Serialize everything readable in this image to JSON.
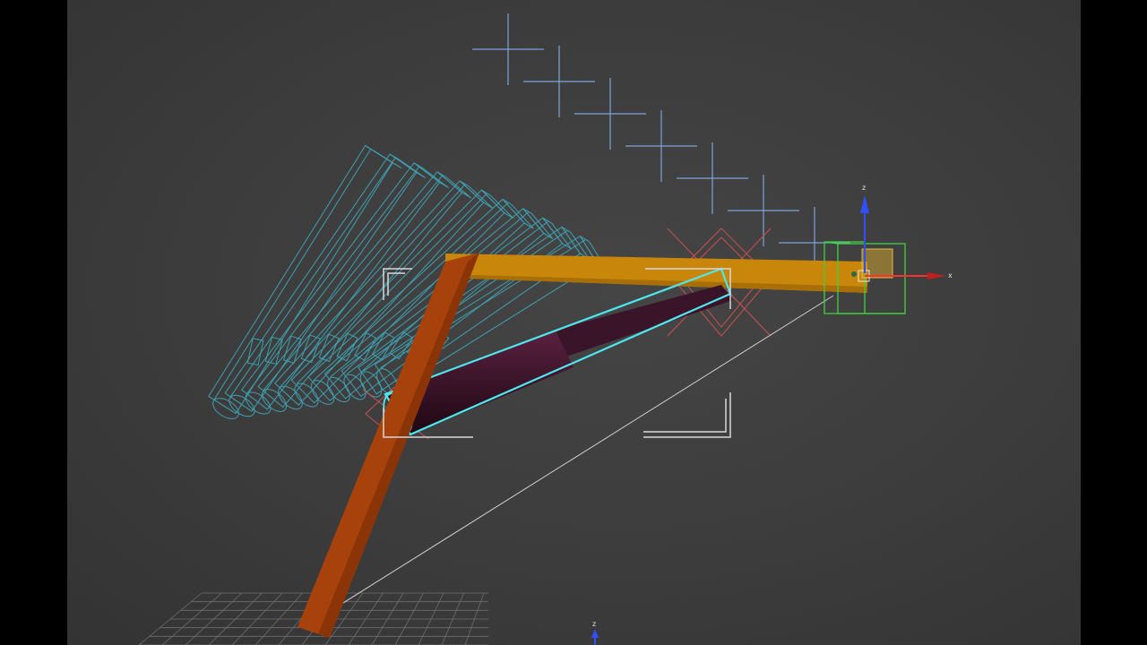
{
  "viewport": {
    "background": "#3f3f3f",
    "letterbox_color": "#000000"
  },
  "gizmo_main": {
    "axis_z": "z",
    "axis_x": "x"
  },
  "gizmo_bottom": {
    "axis_z": "z"
  },
  "colors": {
    "ghost_wireframe": "#3f9fb0",
    "helper_cross": "#7fa3d8",
    "arm_horizontal": "#c8860a",
    "arm_diagonal": "#a8420c",
    "piston_body": "#3a1428",
    "piston_outline": "#4fe6ef",
    "target_cross": "#c85050",
    "selection_bracket": "#d8d8d8",
    "ground_grid": "#707070",
    "gizmo_box": "#40d040"
  }
}
